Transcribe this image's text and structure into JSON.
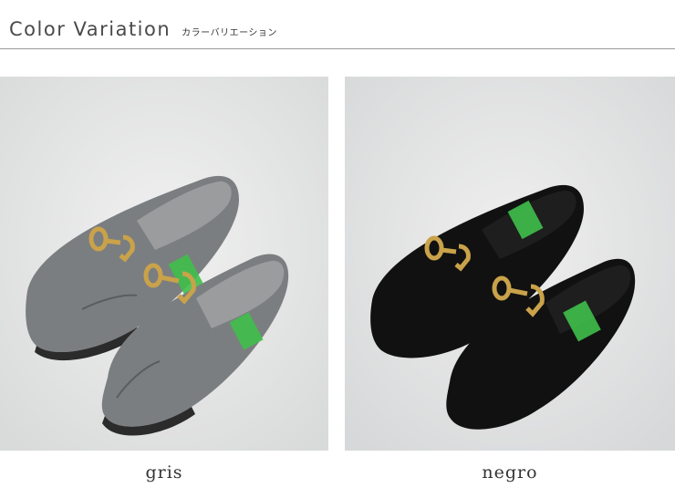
{
  "header": {
    "title": "Color Variation",
    "subtitle": "カラーバリエーション"
  },
  "variants": [
    {
      "label": "gris",
      "shoe_color": "#7b7e80",
      "shoe_shade": "#5a5d60",
      "lining": "#9a9c9d",
      "sole": "#2b2b2b"
    },
    {
      "label": "negro",
      "shoe_color": "#111111",
      "shoe_shade": "#050505",
      "lining": "#1e1e1e",
      "sole": "#0a0a0a"
    }
  ],
  "colors": {
    "buckle": "#c9a24a",
    "rule": "#9a9a9a",
    "tag_green": "#3fbf4a"
  }
}
